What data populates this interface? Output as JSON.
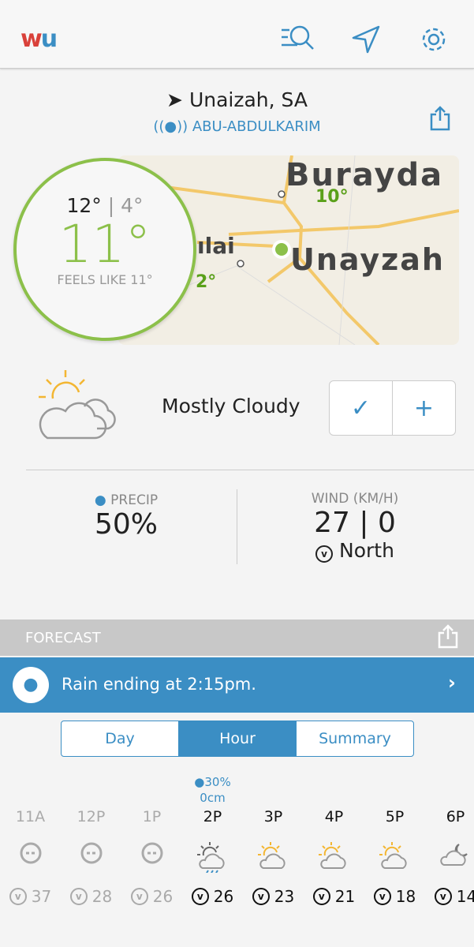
{
  "header": {
    "logo": "wu",
    "icons": [
      "search-list-icon",
      "location-arrow-icon",
      "gear-icon"
    ]
  },
  "location": {
    "name": "Unaizah, SA",
    "station": "ABU-ABDULKARIM"
  },
  "map": {
    "labels": {
      "city1": "Burayda",
      "temp1": "10°",
      "city2": "Unayzah",
      "city3": "ılai",
      "temp3": "2°"
    }
  },
  "current": {
    "high": "12°",
    "sep": "|",
    "low": "4°",
    "temp": "11°",
    "feels": "FEELS LIKE 11°",
    "condition": "Mostly Cloudy"
  },
  "precip": {
    "label": "PRECIP",
    "value": "50%"
  },
  "wind": {
    "label": "WIND (KM/H)",
    "value": "27 | 0",
    "direction": "North"
  },
  "forecast": {
    "title": "FORECAST",
    "banner": "Rain ending at 2:15pm.",
    "tabs": [
      "Day",
      "Hour",
      "Summary"
    ],
    "active_tab": "Hour"
  },
  "hours": [
    {
      "time": "11A",
      "icon": "fog",
      "wind": "37",
      "past": true
    },
    {
      "time": "12P",
      "icon": "fog",
      "wind": "28",
      "past": true
    },
    {
      "time": "1P",
      "icon": "fog",
      "wind": "26",
      "past": true
    },
    {
      "time": "2P",
      "icon": "chance-rain",
      "wind": "26",
      "past": false,
      "precip": "30%",
      "amount": "0cm"
    },
    {
      "time": "3P",
      "icon": "mostly-cloudy",
      "wind": "23",
      "past": false
    },
    {
      "time": "4P",
      "icon": "mostly-cloudy",
      "wind": "21",
      "past": false
    },
    {
      "time": "5P",
      "icon": "partly-cloudy",
      "wind": "18",
      "past": false
    },
    {
      "time": "6P",
      "icon": "partly-cloudy-night",
      "wind": "14",
      "past": false
    }
  ],
  "colors": {
    "accent": "#3b8ec4",
    "temp": "#8cc04a"
  }
}
